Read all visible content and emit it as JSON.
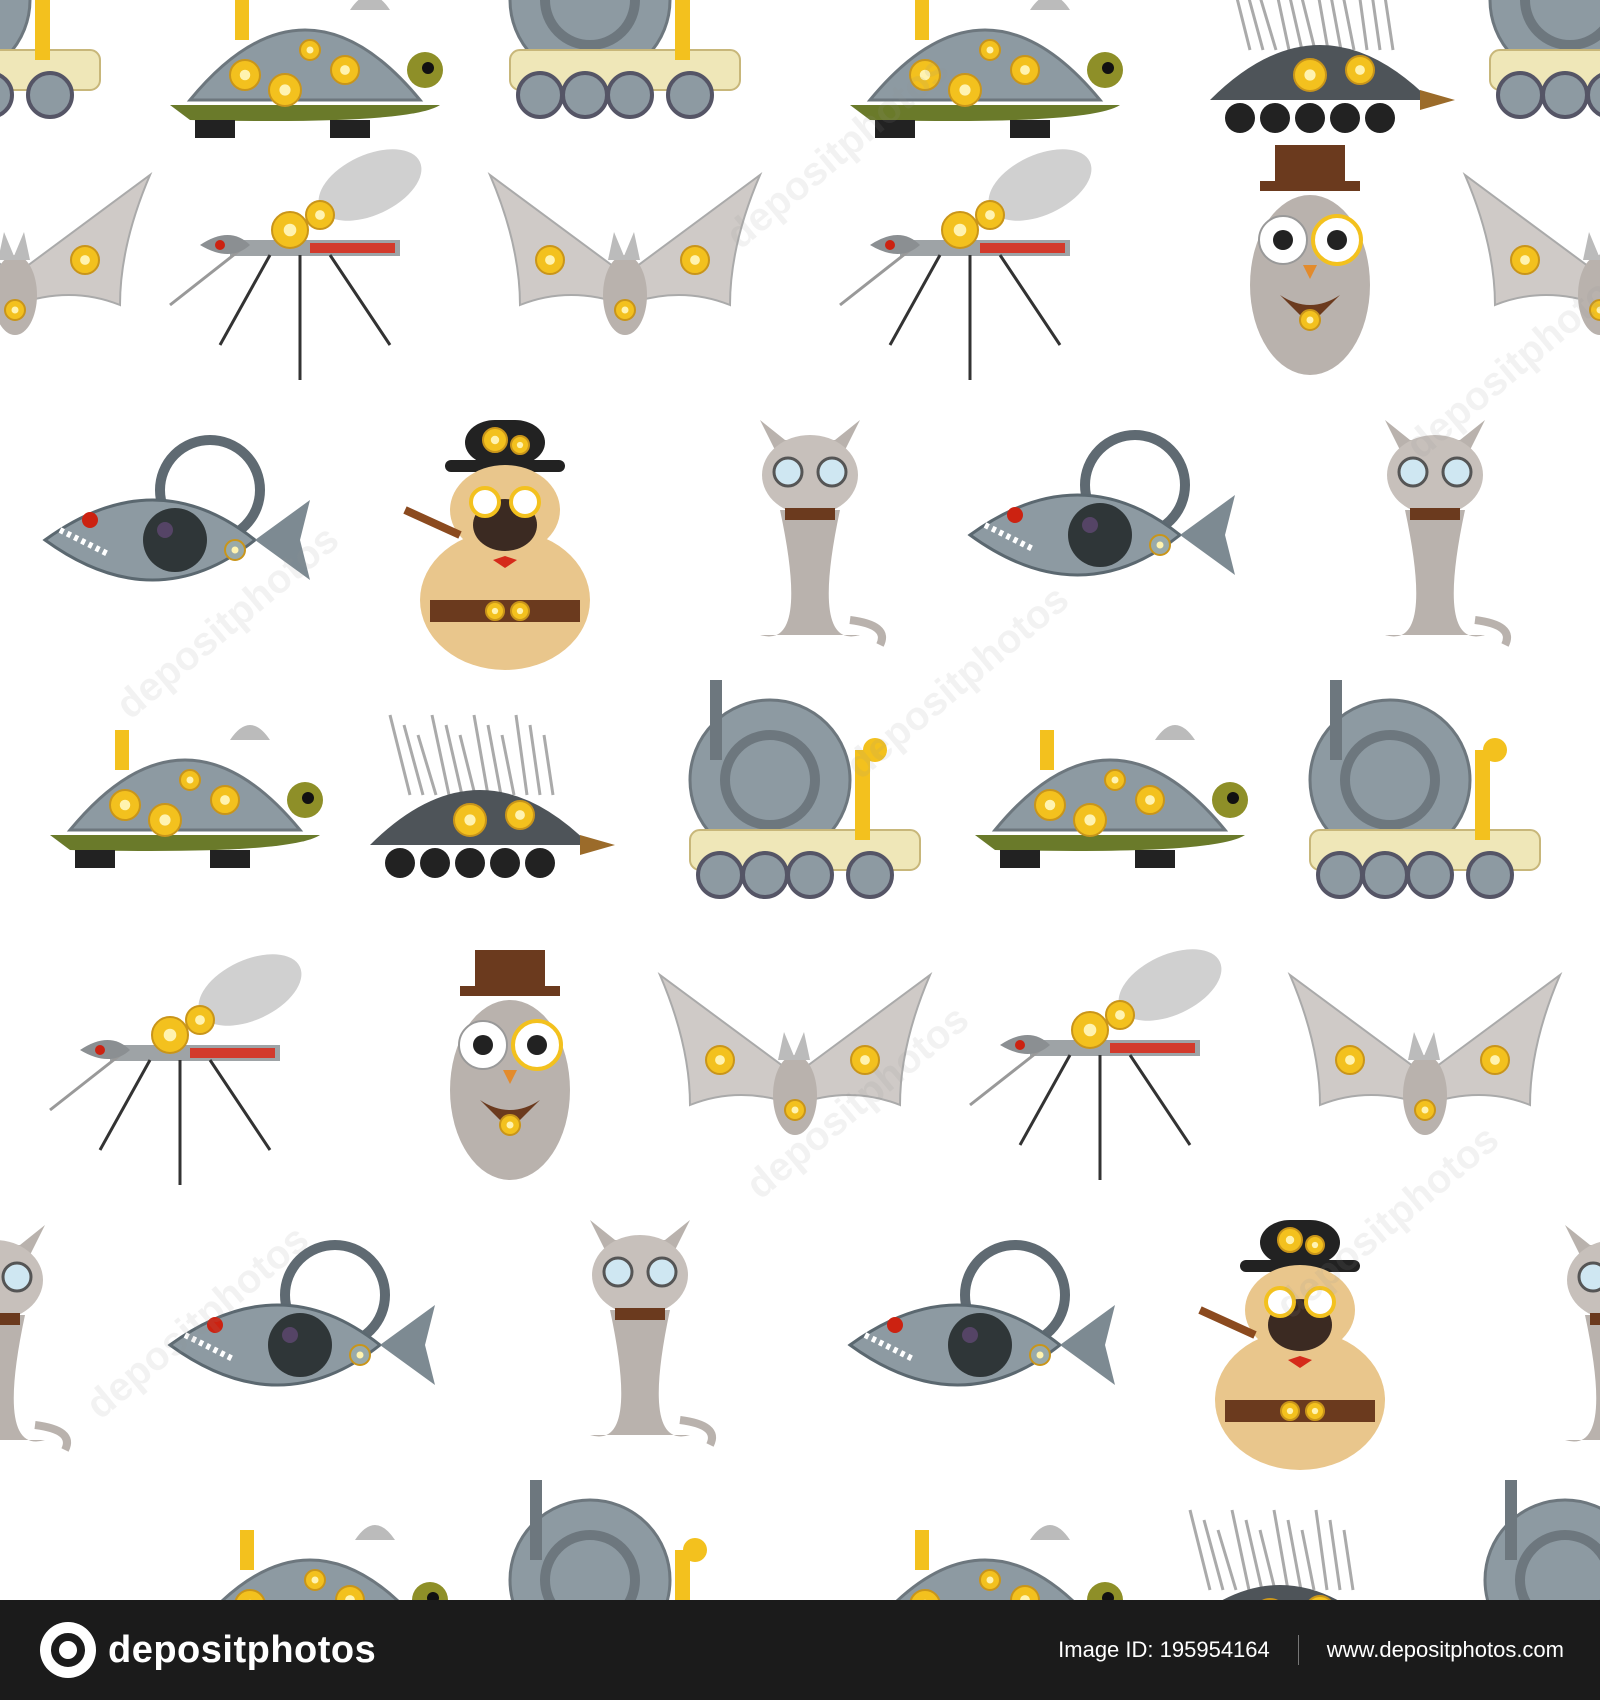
{
  "watermark": {
    "logo_text": "depositphotos",
    "image_id_label": "Image ID:",
    "image_id": "195954164",
    "site_url": "www.depositphotos.com"
  },
  "pattern": {
    "description_items": [
      "turtle-robot",
      "snail-rover",
      "hedgehog-tank",
      "bat-robot",
      "mosquito-robot",
      "owl-robot",
      "fish-robot",
      "pug-robot",
      "cat-robot"
    ]
  },
  "colors": {
    "background": "#ffffff",
    "footer": "#1b1b1b",
    "metal": "#8d9aa2",
    "gold": "#f3c11e",
    "grey_wing": "#cfcac7"
  }
}
